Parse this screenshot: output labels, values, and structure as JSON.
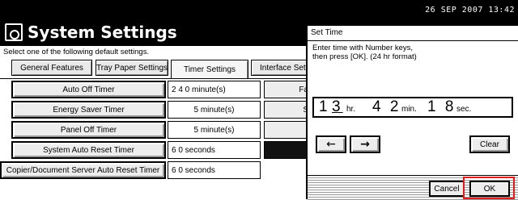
{
  "status": {
    "clock": "26 SEP   2007 13:42"
  },
  "header": {
    "title": "System Settings",
    "icon": "settings-panel-icon"
  },
  "instruction": "Select one of the following default settings.",
  "tabs": [
    {
      "label": "General Features"
    },
    {
      "label": "Tray Paper Settings"
    },
    {
      "label": "Timer Settings",
      "active": true
    },
    {
      "label": "Interface Sett"
    }
  ],
  "settings": [
    {
      "label": "Auto Off Timer",
      "value": "2 4 0  minute(s)",
      "stub": "Fa"
    },
    {
      "label": "Energy Saver Timer",
      "value": "5  minute(s)",
      "stub": "S"
    },
    {
      "label": "Panel Off Timer",
      "value": "5  minute(s)",
      "stub": ""
    },
    {
      "label": "System Auto Reset Timer",
      "value": "6 0  seconds",
      "stub": ""
    },
    {
      "label": "Copier/Document Server Auto Reset Timer",
      "value": "6 0  seconds",
      "stub": ""
    }
  ],
  "dialog": {
    "title": "Set Time",
    "message_line1": "Enter time with Number keys,",
    "message_line2": "then press [OK]. (24 hr format)",
    "time": {
      "hour_first": "1",
      "hour_second": "3",
      "hour_unit": "hr.",
      "minute": "4 2",
      "minute_unit": "min.",
      "second": "1 8",
      "second_unit": "sec."
    },
    "left_arrow": "←",
    "right_arrow": "→",
    "clear_label": "Clear",
    "cancel_label": "Cancel",
    "ok_label": "OK",
    "highlight_color": "#e21b1b"
  }
}
